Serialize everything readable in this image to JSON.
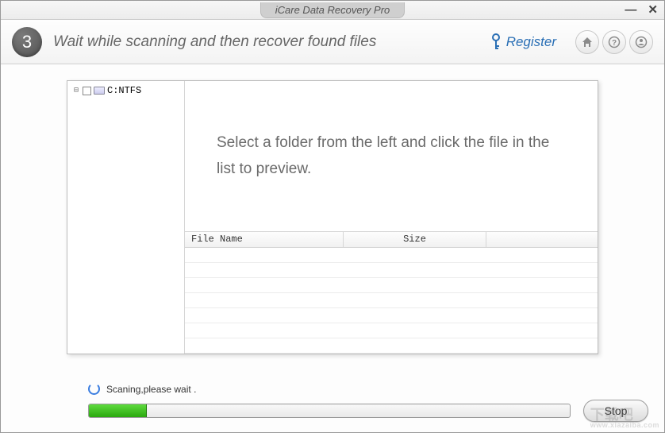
{
  "window": {
    "title": "iCare Data Recovery Pro"
  },
  "header": {
    "step_number": "3",
    "instruction": "Wait while scanning and then recover found files",
    "register_label": "Register"
  },
  "tree": {
    "items": [
      {
        "label": "C:NTFS"
      }
    ]
  },
  "preview": {
    "message": "Select a folder from the left and click the file in the list to preview."
  },
  "table": {
    "columns": {
      "c1": "File Name",
      "c2": "Size",
      "c3": ""
    }
  },
  "status": {
    "text": "Scaning,please wait .",
    "progress_percent": 12,
    "stop_label": "Stop"
  },
  "watermark": {
    "main": "下载吧",
    "sub": "www.xiazaiba.com"
  }
}
